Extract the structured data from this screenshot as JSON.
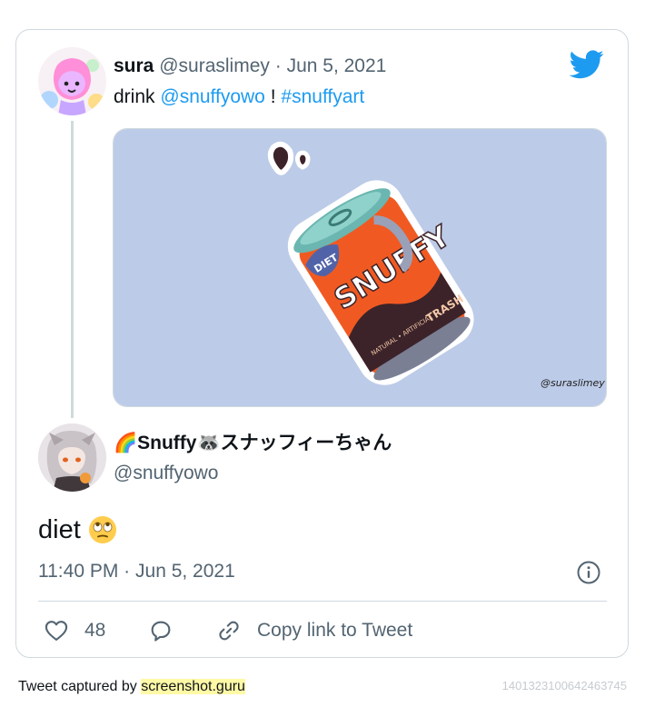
{
  "quoted": {
    "name": "sura",
    "handle": "@suraslimey",
    "separator": "·",
    "date": "Jun 5, 2021",
    "text_prefix": "drink",
    "mention": "@snuffyowo",
    "text_mid": "!",
    "hashtag": "#snuffyart",
    "image_watermark": "@suraslimey"
  },
  "reply": {
    "name": "🌈Snuffy🦝スナッフィーちゃん",
    "handle": "@snuffyowo",
    "text": "diet",
    "emoji": "face-with-rolling-eyes",
    "time": "11:40 PM",
    "separator": "·",
    "date": "Jun 5, 2021"
  },
  "actions": {
    "like_count": "48",
    "copy_link_label": "Copy link to Tweet"
  },
  "footer": {
    "captured_prefix": "Tweet captured by",
    "captured_site": "screenshot.guru",
    "tweet_id": "1401323100642463745"
  },
  "colors": {
    "accent": "#1d9bf0",
    "muted": "#536471",
    "border": "#cfd9de",
    "media_background": "#bccbe8"
  },
  "icons": [
    "twitter-bird-icon",
    "heart-icon",
    "reply-bubble-icon",
    "link-icon",
    "info-icon"
  ]
}
